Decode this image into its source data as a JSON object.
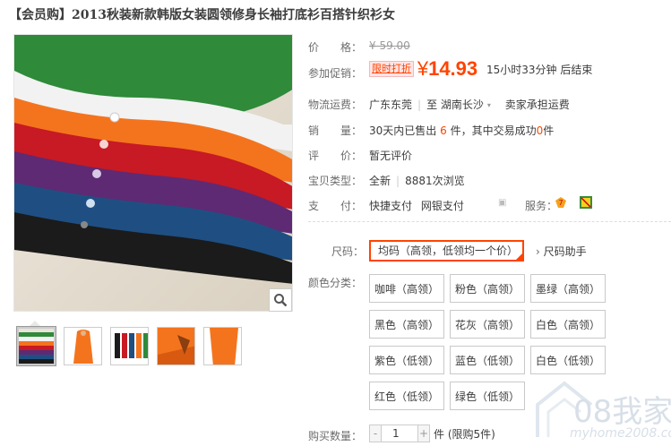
{
  "product": {
    "title": "【会员购】2013秋装新款韩版女装圆领修身长袖打底衫百搭针织衫女"
  },
  "price": {
    "label": "价　　格：",
    "original": "¥ 59.00"
  },
  "promo": {
    "label": "参加促销：",
    "tag": "限时打折",
    "currency": "¥",
    "price": "14.93",
    "countdown": "15小时33分钟 后结束"
  },
  "shipping": {
    "label": "物流运费：",
    "from": "广东东莞",
    "to_prefix": "至",
    "to": "湖南长沙",
    "fee": "卖家承担运费"
  },
  "sales": {
    "label": "销　　量：",
    "text_a": "30天内已售出",
    "sold": "6",
    "text_b": "件，其中交易成功",
    "success": "0",
    "text_c": "件"
  },
  "review": {
    "label": "评　　价：",
    "value": "暂无评价"
  },
  "item_type": {
    "label": "宝贝类型：",
    "condition": "全新",
    "views": "8881次浏览"
  },
  "payment": {
    "label": "支　　付：",
    "method_a": "快捷支付",
    "method_b": "网银支付",
    "service_label": "服务："
  },
  "size": {
    "label": "尺码：",
    "selected": "均码（高领，低领均一个价）",
    "helper": "尺码助手"
  },
  "colors": {
    "label": "颜色分类：",
    "options": [
      "咖啡（高领）",
      "粉色（高领）",
      "墨绿（高领）",
      "黑色（高领）",
      "花灰（高领）",
      "白色（高领）",
      "紫色（低领）",
      "蓝色（低领）",
      "白色（低领）",
      "红色（低领）",
      "绿色（低领）"
    ]
  },
  "quantity": {
    "label": "购买数量：",
    "value": "1",
    "minus": "-",
    "plus": "+",
    "unit": "件 (限购5件)"
  },
  "watermark": {
    "brand": "08我家",
    "site": "myhome2008.com"
  },
  "colors_theme": {
    "accent": "#ff4400",
    "border": "#c9c9c9"
  }
}
